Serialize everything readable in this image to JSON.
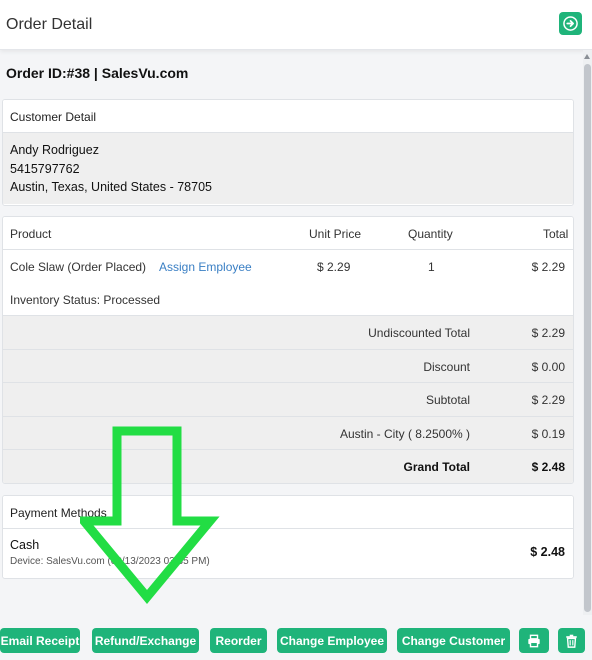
{
  "header": {
    "title": "Order Detail",
    "exit_icon": "arrow-right-icon"
  },
  "order": {
    "id_label": "Order ID:#38 | SalesVu.com"
  },
  "customer": {
    "heading": "Customer Detail",
    "name": "Andy Rodriguez",
    "phone": "5415797762",
    "address": "Austin, Texas, United States - 78705"
  },
  "products": {
    "columns": {
      "product": "Product",
      "unit_price": "Unit Price",
      "quantity": "Quantity",
      "total": "Total"
    },
    "items": [
      {
        "name": "Cole Slaw (Order Placed)",
        "assign_link": "Assign Employee",
        "unit_price": "$ 2.29",
        "quantity": "1",
        "total": "$ 2.29",
        "inventory_status": "Inventory Status: Processed"
      }
    ]
  },
  "summary": [
    {
      "label": "Undiscounted Total",
      "value": "$ 2.29"
    },
    {
      "label": "Discount",
      "value": "$ 0.00"
    },
    {
      "label": "Subtotal",
      "value": "$ 2.29"
    },
    {
      "label": "Austin - City ( 8.2500% )",
      "value": "$ 0.19"
    },
    {
      "label": "Grand Total",
      "value": "$ 2.48"
    }
  ],
  "payment": {
    "heading": "Payment Methods",
    "method": "Cash",
    "device": "Device: SalesVu.com (09/13/2023 03:35 PM)",
    "amount": "$ 2.48"
  },
  "actions": {
    "email_receipt": "Email Receipt",
    "refund_exchange": "Refund/Exchange",
    "reorder": "Reorder",
    "change_employee": "Change Employee",
    "change_customer": "Change Customer",
    "print_icon": "printer-icon",
    "delete_icon": "trash-icon"
  },
  "colors": {
    "accent": "#1fb47a",
    "link": "#3a7fc4",
    "overlay_arrow": "#22dd44"
  }
}
